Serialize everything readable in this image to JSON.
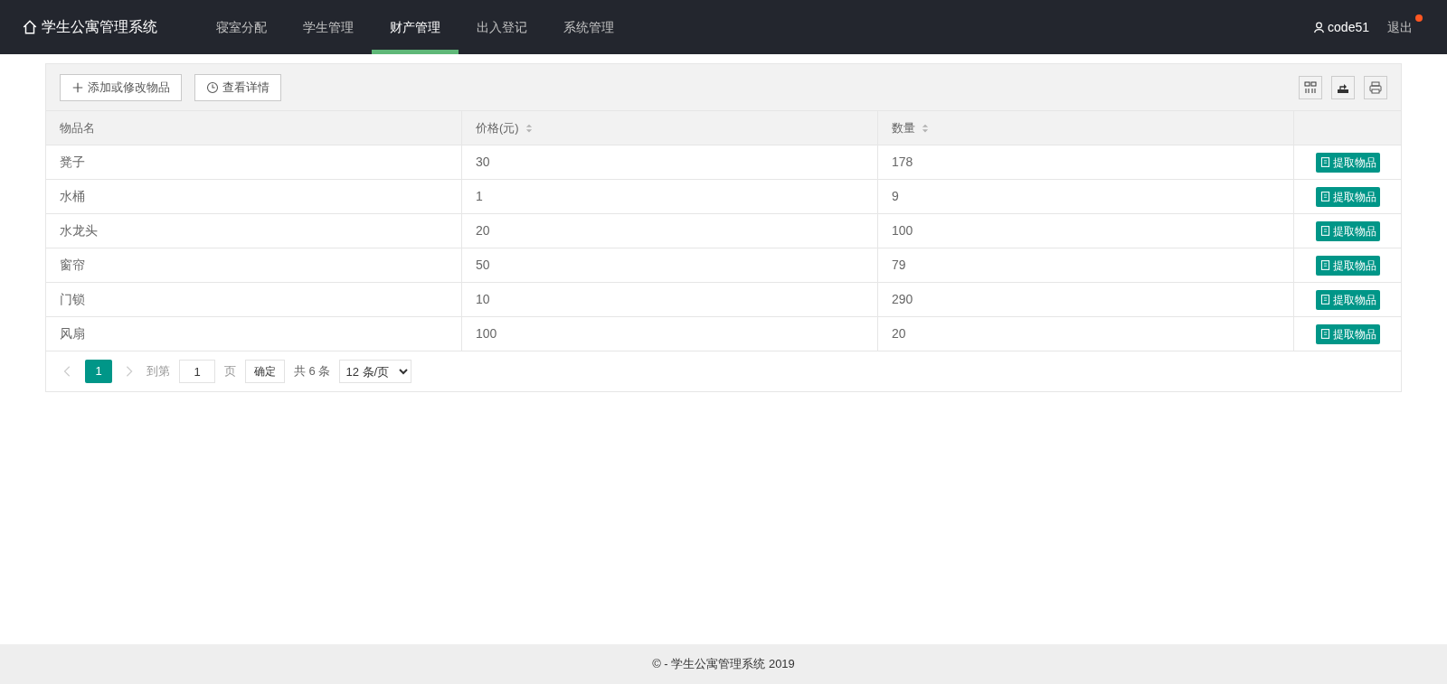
{
  "header": {
    "logo": "学生公寓管理系统",
    "nav": [
      {
        "label": "寝室分配",
        "selected": false
      },
      {
        "label": "学生管理",
        "selected": false
      },
      {
        "label": "财产管理",
        "selected": true
      },
      {
        "label": "出入登记",
        "selected": false
      },
      {
        "label": "系统管理",
        "selected": false
      }
    ],
    "user": "code51",
    "logout": {
      "label": "退出",
      "dot": true
    }
  },
  "toolbar": {
    "buttons": [
      {
        "label": "添加或修改物品",
        "kind": "add"
      },
      {
        "label": "查看详情",
        "kind": "clock"
      }
    ],
    "tools": [
      {
        "kind": "columns"
      },
      {
        "kind": "export"
      },
      {
        "kind": "print"
      }
    ]
  },
  "table": {
    "columns": [
      {
        "label": "物品名",
        "sortable": false
      },
      {
        "label": "价格(元)",
        "sortable": true
      },
      {
        "label": "数量",
        "sortable": true
      }
    ],
    "rows": [
      {
        "cells": [
          "凳子",
          "30",
          "178"
        ],
        "action": "提取物品"
      },
      {
        "cells": [
          "水桶",
          "1",
          "9"
        ],
        "action": "提取物品"
      },
      {
        "cells": [
          "水龙头",
          "20",
          "100"
        ],
        "action": "提取物品"
      },
      {
        "cells": [
          "窗帘",
          "50",
          "79"
        ],
        "action": "提取物品"
      },
      {
        "cells": [
          "门锁",
          "10",
          "290"
        ],
        "action": "提取物品"
      },
      {
        "cells": [
          "风扇",
          "100",
          "20"
        ],
        "action": "提取物品"
      }
    ]
  },
  "pagination": {
    "pages": [
      {
        "label": "1",
        "selected": true
      }
    ],
    "goto_label": "到第",
    "goto_value": "1",
    "page_unit": "页",
    "confirm": "确定",
    "total": "共 6 条",
    "page_size": "12 条/页"
  },
  "footer": "© - 学生公寓管理系统 2019"
}
